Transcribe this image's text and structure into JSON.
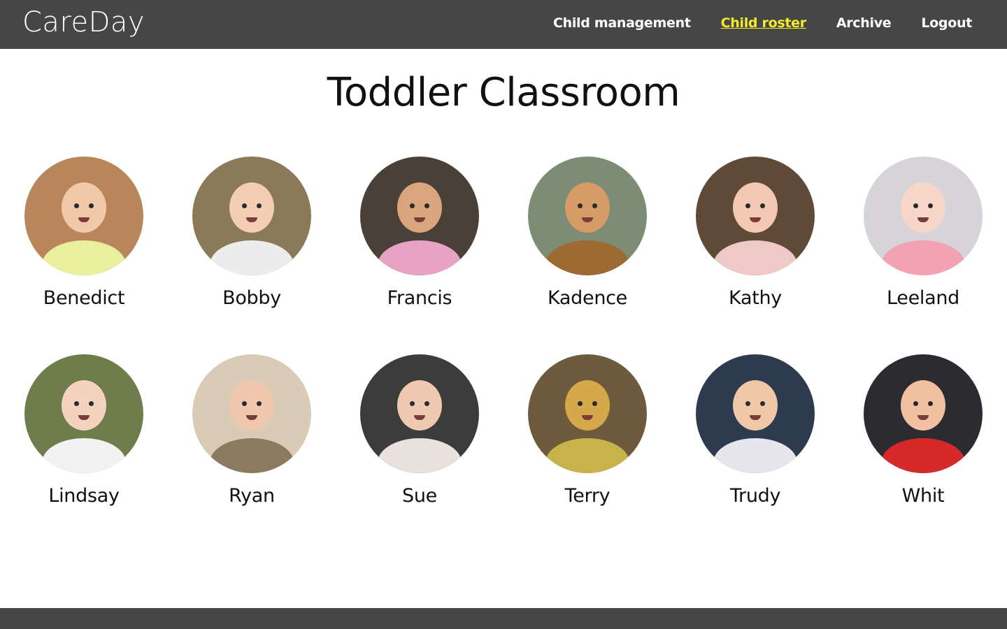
{
  "app": {
    "brand": "CareDay"
  },
  "nav": {
    "items": [
      {
        "label": "Child management",
        "active": false
      },
      {
        "label": "Child roster",
        "active": true
      },
      {
        "label": "Archive",
        "active": false
      },
      {
        "label": "Logout",
        "active": false
      }
    ]
  },
  "page": {
    "title": "Toddler Classroom"
  },
  "colors": {
    "header_bg": "#464646",
    "active_link": "#f2ec2b"
  },
  "children": [
    {
      "name": "Benedict",
      "bg": "#b8865a",
      "skin": "#f0c9a8",
      "shirt": "#e9ef9c"
    },
    {
      "name": "Bobby",
      "bg": "#8a7a58",
      "skin": "#f3ceb2",
      "shirt": "#ececec"
    },
    {
      "name": "Francis",
      "bg": "#4a4038",
      "skin": "#d9a57f",
      "shirt": "#e8a2c4"
    },
    {
      "name": "Kadence",
      "bg": "#7d8c74",
      "skin": "#d79b68",
      "shirt": "#9c6a32"
    },
    {
      "name": "Kathy",
      "bg": "#5e4a36",
      "skin": "#f4c9b4",
      "shirt": "#efc8c8"
    },
    {
      "name": "Leeland",
      "bg": "#d6d4d8",
      "skin": "#f6d7c8",
      "shirt": "#f3a2b4"
    },
    {
      "name": "Lindsay",
      "bg": "#6f7d4c",
      "skin": "#f3d2c0",
      "shirt": "#f2f2f2"
    },
    {
      "name": "Ryan",
      "bg": "#d9cbb5",
      "skin": "#efc7ad",
      "shirt": "#8a7a60"
    },
    {
      "name": "Sue",
      "bg": "#3c3c3c",
      "skin": "#eec8b0",
      "shirt": "#e9e2dc"
    },
    {
      "name": "Terry",
      "bg": "#6e5a3c",
      "skin": "#d5a84a",
      "shirt": "#c8b24a"
    },
    {
      "name": "Trudy",
      "bg": "#2e3a4e",
      "skin": "#f0c8a8",
      "shirt": "#e6e6ec"
    },
    {
      "name": "Whit",
      "bg": "#2c2c30",
      "skin": "#f1c0a0",
      "shirt": "#d62a2a"
    }
  ]
}
